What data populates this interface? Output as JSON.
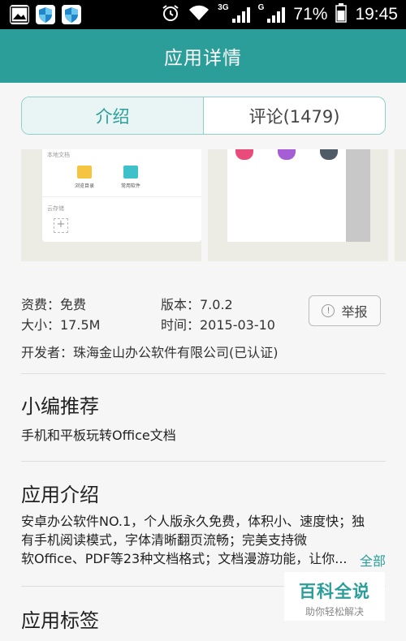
{
  "status_bar": {
    "net_type_1": "3G",
    "net_type_2": "G",
    "battery": "71%",
    "time": "19:45",
    "icons": [
      "gallery-icon",
      "shield-icon",
      "shield-icon",
      "alarm-icon",
      "wifi-icon",
      "signal-icon",
      "battery-icon"
    ]
  },
  "header": {
    "title": "应用详情"
  },
  "tabs": [
    {
      "label": "介绍",
      "active": true
    },
    {
      "label": "评论(1479)",
      "active": false
    }
  ],
  "screenshots": {
    "shot1": {
      "section_local": "本地文档",
      "item1": "浏览目录",
      "item2": "常用软件",
      "section_cloud": "云存储",
      "add_glyph": "+"
    }
  },
  "info": {
    "fee": "资费：免费",
    "version": "版本：7.0.2",
    "size": "大小：17.5M",
    "date": "时间：2015-03-10",
    "developer": "开发者：珠海金山办公软件有限公司(已认证)",
    "report_label": "举报"
  },
  "editor_pick": {
    "title": "小编推荐",
    "text": "手机和平板玩转Office文档"
  },
  "app_intro": {
    "title": "应用介绍",
    "lines": [
      "安卓办公软件NO.1，个人版永久免费，体积小、速度快；独",
      "有手机阅读模式，字体清晰翻页流畅；完美支持微",
      "软Office、PDF等23种文档格式；文档漫游功能，让你..."
    ],
    "more_label": "全部"
  },
  "app_tags": {
    "title": "应用标签"
  },
  "watermark": {
    "big": "百科全说",
    "small": "助你轻松解决"
  },
  "colors": {
    "accent": "#2b9e9a",
    "folder_yellow": "#f5c542",
    "folder_teal": "#3fc1c9",
    "dot_pink": "#e94b7a",
    "dot_purple": "#a55ed6",
    "dot_slate": "#4f5b66"
  }
}
